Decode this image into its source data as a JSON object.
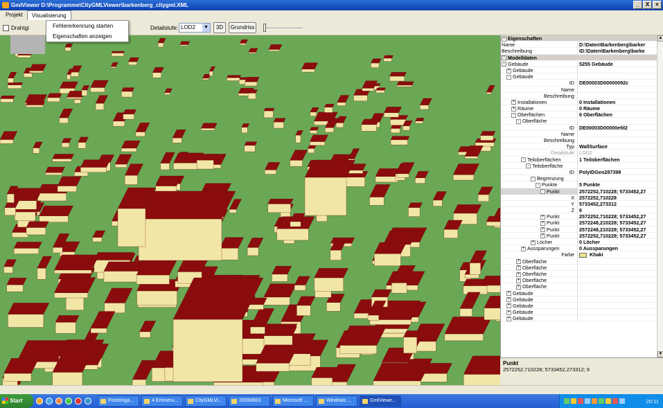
{
  "window": {
    "title": "GmlViewer D:\\Programme\\CityGMLViewer\\barkenberg_citygml.XML",
    "minimize": "_",
    "restore": "Х",
    "close": "×"
  },
  "menu": {
    "items": [
      "Projekt",
      "Visualisierung"
    ],
    "dropdown": [
      "Fehlererkennung starten",
      "Eigenschaften anzeigen"
    ]
  },
  "toolbar": {
    "wireframe_label": "Drahtgi",
    "detail_label": "Detailstufe:",
    "detail_value": "LOD2",
    "btn_3d": "3D",
    "btn_grundriss": "Grundriss"
  },
  "colors": {
    "ground": "#6aa855",
    "roof": "#8b0c0c",
    "wall": "#f2e6a6"
  },
  "properties": {
    "rows": [
      {
        "n": "Eigenschaften",
        "v": "",
        "lvl": 0,
        "cat": true,
        "e": "-"
      },
      {
        "n": "Name",
        "v": "D:\\Daten\\Barkenberg\\barker",
        "lvl": 0
      },
      {
        "n": "Beschreibung",
        "v": "ID:\\Daten\\Barkenberg\\barke",
        "lvl": 0
      },
      {
        "n": "Modelldaten",
        "v": "",
        "lvl": 0,
        "cat": true,
        "e": "-"
      },
      {
        "n": "Gebäude",
        "v": "5255 Gebäude",
        "lvl": 0,
        "e": "-"
      },
      {
        "n": "Gebäude",
        "v": "",
        "lvl": 1,
        "e": "+"
      },
      {
        "n": "Gebäude",
        "v": "",
        "lvl": 1,
        "e": "-"
      },
      {
        "n": "ID",
        "v": "DE00003D00000092c",
        "lvl": 3,
        "c": true
      },
      {
        "n": "Name",
        "v": "",
        "lvl": 3,
        "c": true
      },
      {
        "n": "Beschreibung",
        "v": "",
        "lvl": 3,
        "c": true
      },
      {
        "n": "Installationen",
        "v": "0 Installationen",
        "lvl": 2,
        "e": "+"
      },
      {
        "n": "Räume",
        "v": "0 Räume",
        "lvl": 2,
        "e": "+"
      },
      {
        "n": "Oberflächen",
        "v": "6 Oberflächen",
        "lvl": 2,
        "e": "-"
      },
      {
        "n": "Oberfläche",
        "v": "",
        "lvl": 3,
        "e": "-"
      },
      {
        "n": "ID",
        "v": "DE00003D00000efd2",
        "lvl": 5,
        "c": true
      },
      {
        "n": "Name",
        "v": "",
        "lvl": 5,
        "c": true
      },
      {
        "n": "Beschreibung",
        "v": "",
        "lvl": 5,
        "c": true
      },
      {
        "n": "Typ",
        "v": "WallSurface",
        "lvl": 5,
        "c": true
      },
      {
        "n": "Detailstufe",
        "v": "LOD2",
        "lvl": 5,
        "c": true,
        "dim": true
      },
      {
        "n": "Teiloberflächen",
        "v": "1 Teiloberflächen",
        "lvl": 4,
        "e": "-"
      },
      {
        "n": "Teiloberfläche",
        "v": "",
        "lvl": 5,
        "e": "-"
      },
      {
        "n": "ID",
        "v": "PolyIDGeo287398",
        "lvl": 7,
        "c": true
      },
      {
        "n": "Begrenzung",
        "v": "",
        "lvl": 6,
        "e": "-"
      },
      {
        "n": "Punkte",
        "v": "5 Punkte",
        "lvl": 7,
        "e": "-"
      },
      {
        "n": "Punkt",
        "v": "2572252,710228; 5733452,27",
        "lvl": 8,
        "e": "-",
        "sel": true
      },
      {
        "n": "X",
        "v": "2572252,710228",
        "lvl": 9,
        "c": true
      },
      {
        "n": "Y",
        "v": "5733452,273312",
        "lvl": 9,
        "c": true
      },
      {
        "n": "Z",
        "v": "6",
        "lvl": 9,
        "c": true
      },
      {
        "n": "Punkt",
        "v": "2572252,710228; 5733452,27",
        "lvl": 8,
        "e": "+"
      },
      {
        "n": "Punkt",
        "v": "2572248,210228; 5733452,27",
        "lvl": 8,
        "e": "+"
      },
      {
        "n": "Punkt",
        "v": "2572248,210228; 5733452,27",
        "lvl": 8,
        "e": "+"
      },
      {
        "n": "Punkt",
        "v": "2572252,710228; 5733452,27",
        "lvl": 8,
        "e": "+"
      },
      {
        "n": "Löcher",
        "v": "0 Löcher",
        "lvl": 6,
        "e": "+"
      },
      {
        "n": "Aussparungen",
        "v": "0 Aussparungen",
        "lvl": 4,
        "e": "+"
      },
      {
        "n": "Farbe",
        "v": "Khaki",
        "lvl": 5,
        "c": true,
        "sw": true
      },
      {
        "n": "Oberfläche",
        "v": "",
        "lvl": 3,
        "e": "+"
      },
      {
        "n": "Oberfläche",
        "v": "",
        "lvl": 3,
        "e": "+"
      },
      {
        "n": "Oberfläche",
        "v": "",
        "lvl": 3,
        "e": "+"
      },
      {
        "n": "Oberfläche",
        "v": "",
        "lvl": 3,
        "e": "+"
      },
      {
        "n": "Oberfläche",
        "v": "",
        "lvl": 3,
        "e": "+"
      },
      {
        "n": "Gebäude",
        "v": "",
        "lvl": 1,
        "e": "+"
      },
      {
        "n": "Gebäude",
        "v": "",
        "lvl": 1,
        "e": "+"
      },
      {
        "n": "Gebäude",
        "v": "",
        "lvl": 1,
        "e": "+"
      },
      {
        "n": "Gebäude",
        "v": "",
        "lvl": 1,
        "e": "+"
      },
      {
        "n": "Gebäude",
        "v": "",
        "lvl": 1,
        "e": "+"
      }
    ]
  },
  "description": {
    "title": "Punkt",
    "text": "2572252,710228; 5733452,273312; 6"
  },
  "taskbar": {
    "start": "Start",
    "items": [
      "Posteinga...",
      "4 Erinneru...",
      "CityGMLVi...",
      "20090603",
      "Microsoft ...",
      "Windows ...",
      "GmlViewe..."
    ],
    "clock": "20:11"
  }
}
